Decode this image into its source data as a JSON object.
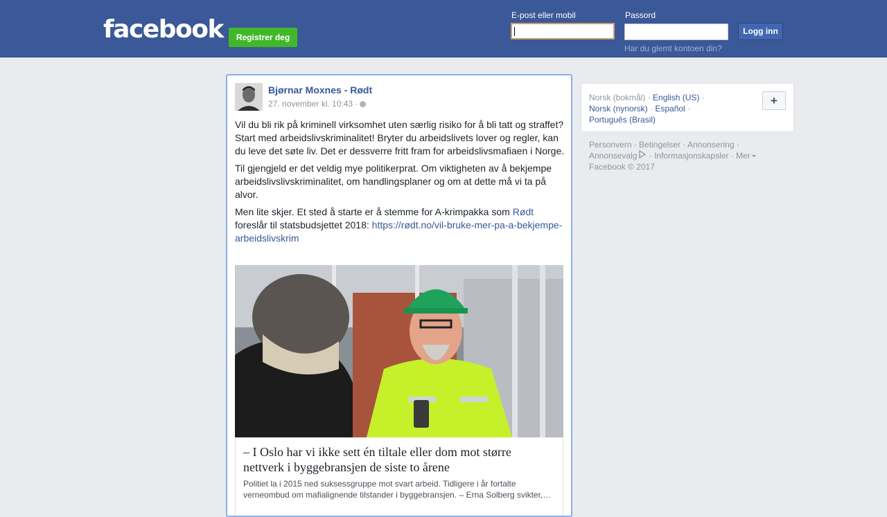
{
  "header": {
    "logo": "facebook",
    "register_label": "Registrer deg",
    "email_label": "E-post eller mobil",
    "password_label": "Passord",
    "login_label": "Logg inn",
    "forgot_label": "Har du glemt kontoen din?"
  },
  "post": {
    "author": "Bjørnar Moxnes - Rødt",
    "timestamp": "27. november kl. 10:43 ·",
    "p1": "Vil du bli rik på kriminell virksomhet uten særlig risiko for å bli tatt og straffet? Start med arbeidslivskriminalitet! Bryter du arbeidslivets lover og regler, kan du leve det søte liv. Det er dessverre fritt fram for arbeidslivsmafiaen i Norge.",
    "p2": "Til gjengjeld er det veldig mye politikerprat. Om viktigheten av å bekjempe arbeidslivslivskriminalitet, om handlingsplaner og om at dette må vi ta på alvor.",
    "p3_a": "Men lite skjer. Et sted å starte er å stemme for A-krimpakka som ",
    "p3_link_party": "Rødt",
    "p3_b": " foreslår til statsbudsjettet 2018: ",
    "p3_url": "https://rødt.no/vil-bruke-mer-pa-a-bekjempe-arbeidslivskrim",
    "card_title": "– I Oslo har vi ikke sett én tiltale eller dom mot større nettverk i byggebransjen de siste to årene",
    "card_desc": "Politiet la i 2015 ned suksessgruppe mot svart arbeid. Tidligere i år fortalte verneombud om mafialignende tilstander i byggebransjen. – Erna Solberg svikter,…"
  },
  "languages": {
    "current": "Norsk (bokmål)",
    "items": [
      "English (US)",
      "Norsk (nynorsk)",
      "Español",
      "Português (Brasil)"
    ],
    "separator": "·",
    "plus": "+"
  },
  "footer": {
    "links": [
      "Personvern",
      "Betingelser",
      "Annonsering",
      "Annonsevalg",
      "Informasjonskapsler",
      "Mer"
    ],
    "copyright": "Facebook © 2017"
  }
}
